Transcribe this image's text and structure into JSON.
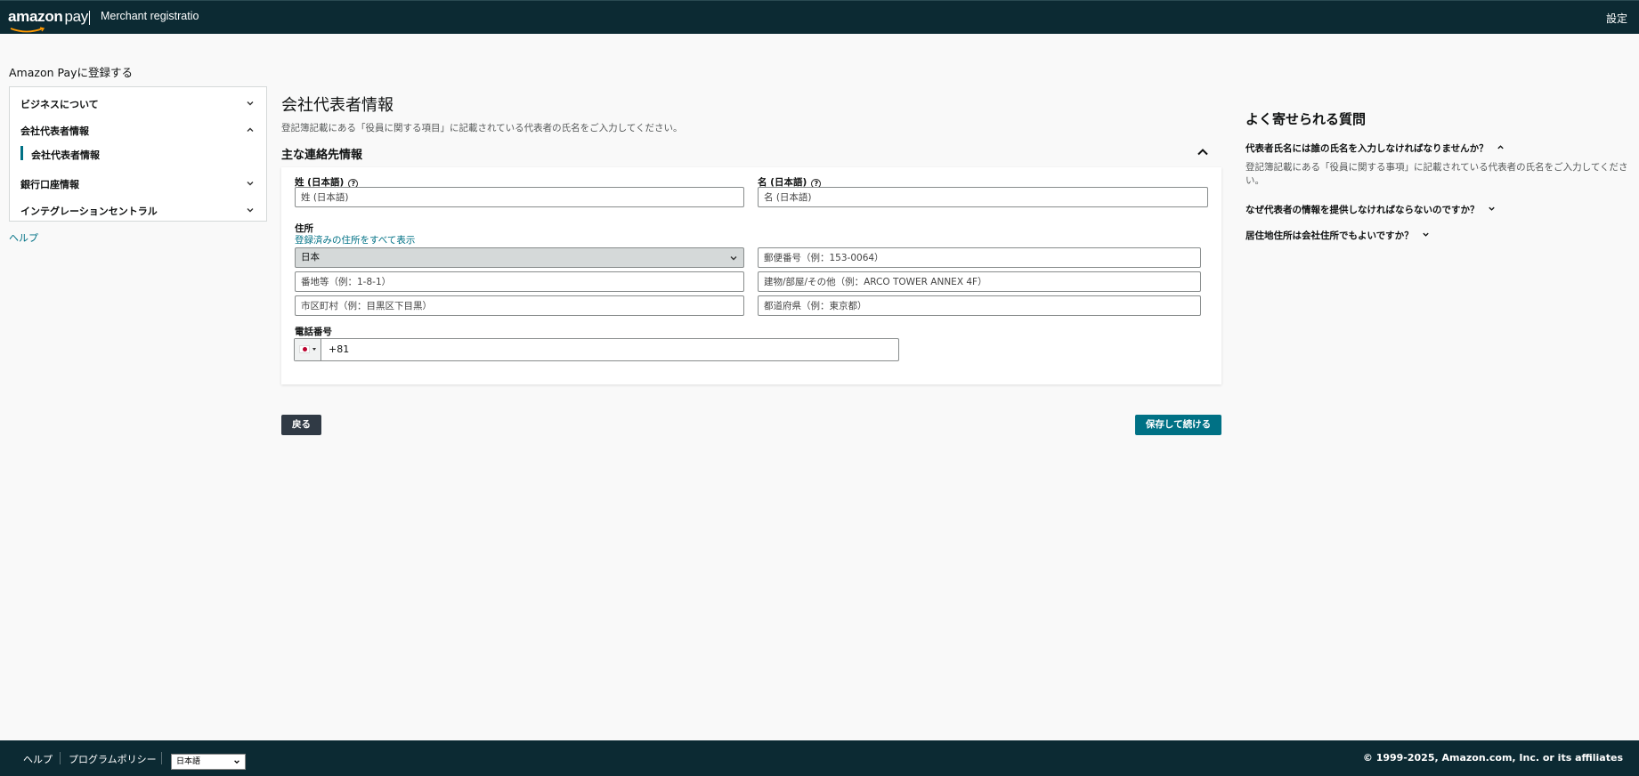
{
  "header": {
    "logo": {
      "word1": "amazon",
      "word2": "pay"
    },
    "app_title": "Merchant registration",
    "settings_label": "設定"
  },
  "sidebar": {
    "title": "Amazon Payに登録する",
    "items": [
      {
        "label": "ビジネスについて",
        "state": "collapsed"
      },
      {
        "label": "会社代表者情報",
        "state": "expanded"
      },
      {
        "label": "銀行口座情報",
        "state": "collapsed"
      },
      {
        "label": "インテグレーションセントラル",
        "state": "collapsed"
      }
    ],
    "active_sub_item": "会社代表者情報",
    "help_link": "ヘルプ"
  },
  "main": {
    "title": "会社代表者情報",
    "subtitle": "登記簿記載にある「役員に関する項目」に記載されている代表者の氏名をご入力してください。",
    "section_title": "主な連絡先情報",
    "form": {
      "last_name": {
        "label": "姓 (日本語)",
        "placeholder": "姓 (日本語)",
        "value": ""
      },
      "first_name": {
        "label": "名 (日本語)",
        "placeholder": "名 (日本語)",
        "value": ""
      },
      "address": {
        "label": "住所",
        "show_all_link": "登録済みの住所をすべて表示",
        "country": "日本",
        "postal_placeholder": "郵便番号（例：153-0064）",
        "street_placeholder": "番地等（例：1-8-1）",
        "building_placeholder": "建物/部屋/その他（例：ARCO TOWER ANNEX 4F）",
        "city_placeholder": "市区町村（例：目黒区下目黒）",
        "prefecture_placeholder": "都道府県（例：東京都）"
      },
      "phone": {
        "label": "電話番号",
        "country_code": "+81"
      }
    },
    "back_button": "戻る",
    "save_button": "保存して続ける"
  },
  "faq": {
    "title": "よく寄せられる質問",
    "items": [
      {
        "question": "代表者氏名には誰の氏名を入力しなければなりませんか？",
        "expanded": true,
        "answer": "登記簿記載にある「役員に関する事項」に記載されている代表者の氏名をご入力してください。"
      },
      {
        "question": "なぜ代表者の情報を提供しなければならないのですか？",
        "expanded": false
      },
      {
        "question": "居住地住所は会社住所でもよいですか？",
        "expanded": false
      }
    ]
  },
  "footer": {
    "help": "ヘルプ",
    "program_policy": "プログラムポリシー",
    "language": "日本語",
    "copyright": "© 1999-2025, Amazon.com, Inc. or its affiliates"
  },
  "colors": {
    "header_bg": "#0c2a33",
    "link": "#007185",
    "primary_button": "#007185",
    "back_button": "#303a45"
  }
}
